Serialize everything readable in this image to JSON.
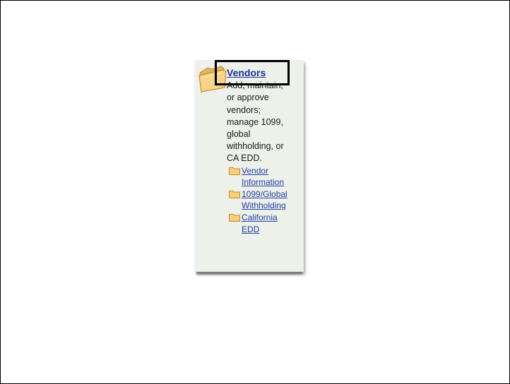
{
  "vendors_card": {
    "title": "Vendors",
    "description": "Add, maintain,\nor approve\nvendors;\nmanage 1099,\nglobal\nwithholding, or\nCA EDD.",
    "icon": "folder-icon",
    "sub_items": [
      {
        "label": "Vendor\nInformation",
        "icon": "folder-icon"
      },
      {
        "label": "1099/Global\nWithholding",
        "icon": "folder-icon"
      },
      {
        "label": "California\nEDD",
        "icon": "folder-icon"
      }
    ]
  },
  "colors": {
    "card_background": "#eef0ea",
    "link": "#1f3fa6",
    "folder_fill": "#f6cf78",
    "folder_edge": "#c98d28"
  }
}
